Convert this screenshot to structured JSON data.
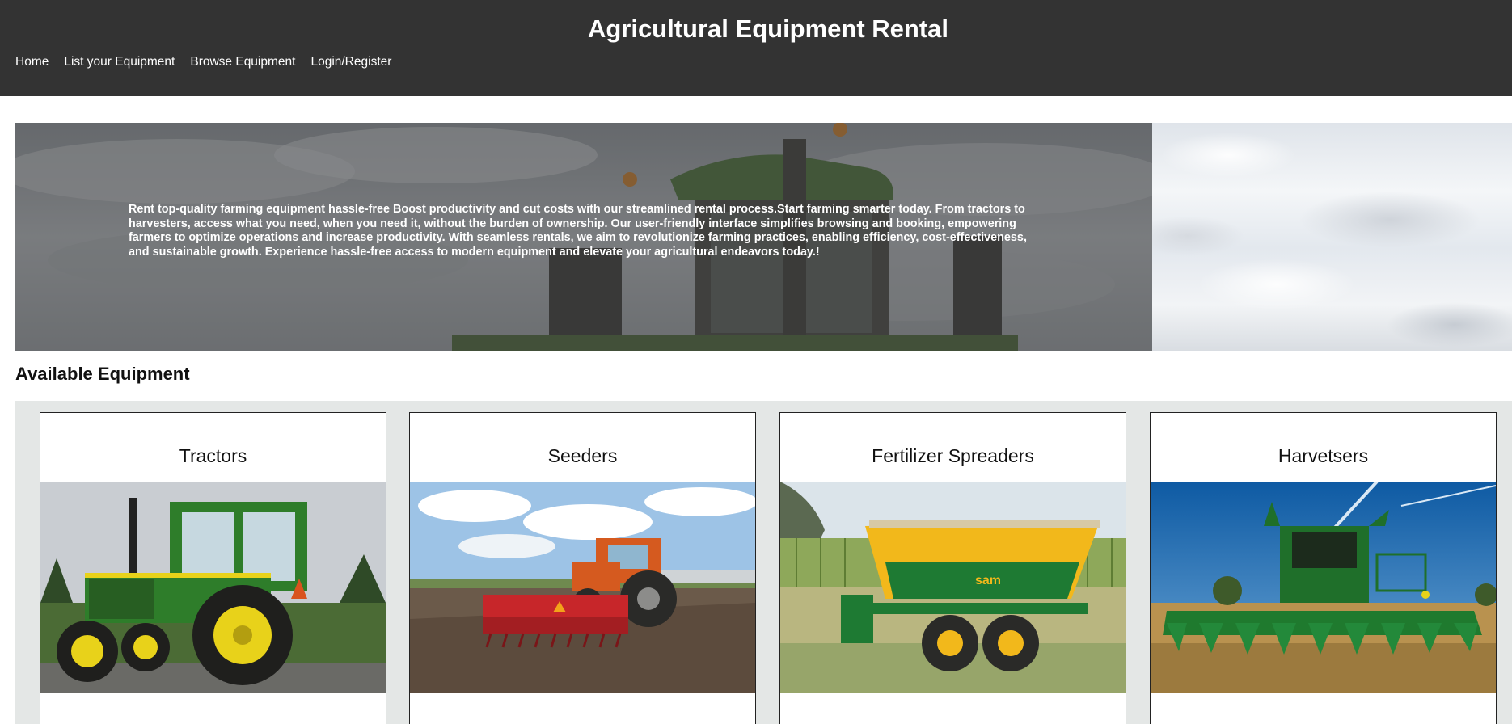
{
  "site": {
    "title": "Agricultural Equipment Rental"
  },
  "nav": {
    "items": [
      {
        "label": "Home"
      },
      {
        "label": "List your Equipment"
      },
      {
        "label": "Browse Equipment"
      },
      {
        "label": "Login/Register"
      }
    ]
  },
  "hero": {
    "text": "Rent top-quality farming equipment hassle-free Boost productivity and cut costs with our streamlined rental process.Start farming smarter today. From tractors to harvesters, access what you need, when you need it, without the burden of ownership. Our user-friendly interface simplifies browsing and booking, empowering farmers to optimize operations and increase productivity. With seamless rentals, we aim to revolutionize farming practices, enabling efficiency, cost-effectiveness, and sustainable growth. Experience hassle-free access to modern equipment and elevate your agricultural endeavors today.!"
  },
  "equipment": {
    "heading": "Available Equipment",
    "items": [
      {
        "title": "Tractors",
        "icon": "tractor-image"
      },
      {
        "title": "Seeders",
        "icon": "seeder-image"
      },
      {
        "title": "Fertilizer Spreaders",
        "icon": "fertilizer-spreader-image",
        "brand_label": "sam"
      },
      {
        "title": "Harvetsers",
        "icon": "harvester-image"
      }
    ]
  },
  "colors": {
    "header_bg": "#333333",
    "equipment_area_bg": "#e4e7e6",
    "john_deere_green": "#2e7d2a",
    "deere_yellow": "#e8d21a"
  }
}
